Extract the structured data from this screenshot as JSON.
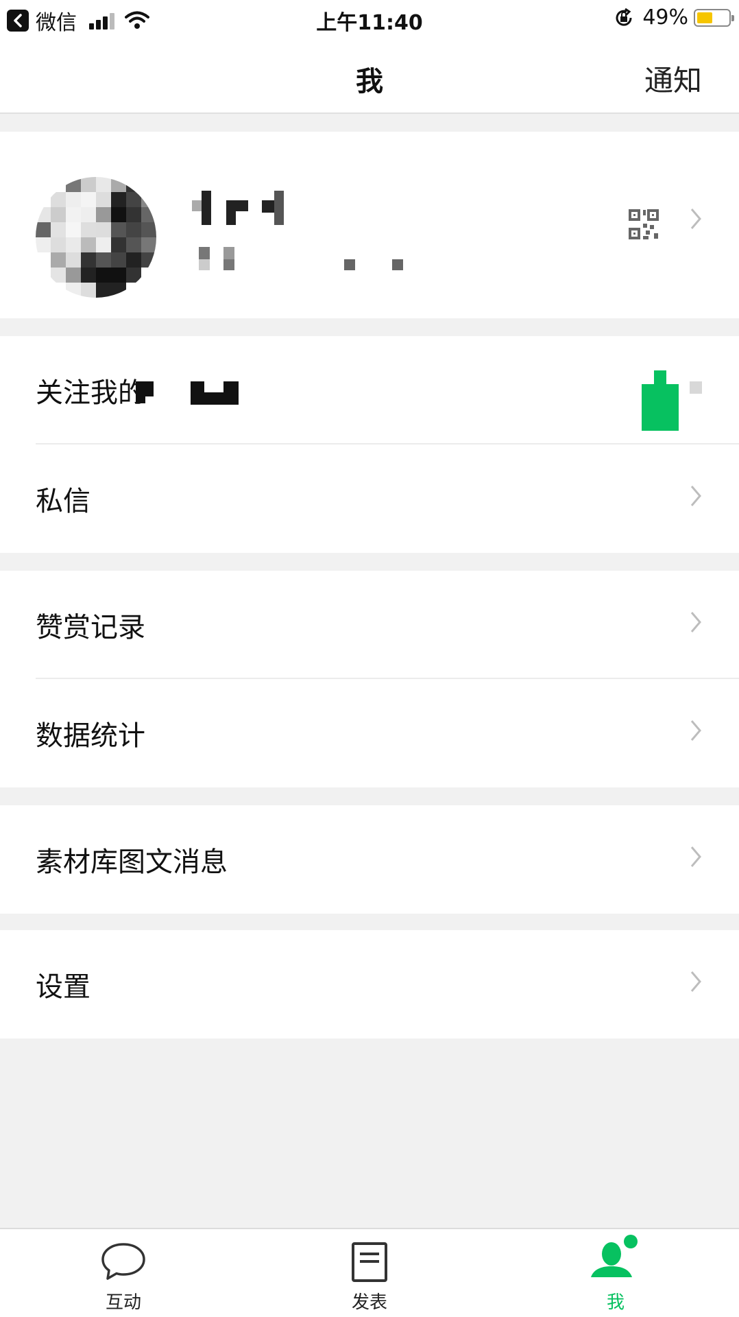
{
  "status_bar": {
    "carrier": "微信",
    "time": "上午11:40",
    "battery_percent": "49%",
    "battery_level": 0.49,
    "battery_color": "#f6c500"
  },
  "nav": {
    "title": "我",
    "right_action": "通知"
  },
  "profile": {
    "qr_icon": "qr-code-icon",
    "chevron_icon": "chevron-right-icon"
  },
  "menu_groups": [
    {
      "items": [
        {
          "label": "关注我的"
        },
        {
          "label": "私信"
        }
      ]
    },
    {
      "items": [
        {
          "label": "赞赏记录"
        },
        {
          "label": "数据统计"
        }
      ]
    },
    {
      "items": [
        {
          "label": "素材库图文消息"
        }
      ]
    },
    {
      "items": [
        {
          "label": "设置"
        }
      ]
    }
  ],
  "tabbar": {
    "accent": "#07c160",
    "tabs": [
      {
        "label": "互动",
        "icon": "chat-bubble-icon",
        "active": false
      },
      {
        "label": "发表",
        "icon": "document-icon",
        "active": false
      },
      {
        "label": "我",
        "icon": "person-icon",
        "active": true
      }
    ]
  }
}
